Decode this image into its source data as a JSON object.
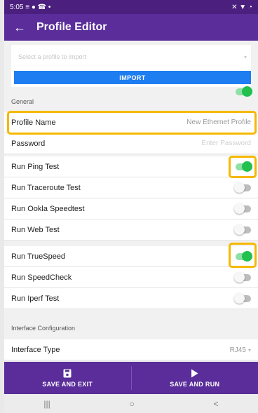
{
  "status_bar": {
    "time": "5:05",
    "left_icons": "≡ ● ☎ •",
    "right_icons": "✕ ▼ ◔"
  },
  "app_bar": {
    "title": "Profile Editor"
  },
  "import": {
    "placeholder": "Select a profile to import",
    "button_label": "IMPORT"
  },
  "general": {
    "header": "General",
    "profile_name": {
      "label": "Profile Name",
      "value": "New Ethernet Profile"
    },
    "password": {
      "label": "Password",
      "placeholder": "Enter Password"
    },
    "toggles": [
      {
        "label": "Run Ping Test",
        "on": true
      },
      {
        "label": "Run Traceroute Test",
        "on": false
      },
      {
        "label": "Run Ookla Speedtest",
        "on": false
      },
      {
        "label": "Run Web Test",
        "on": false
      },
      {
        "label": "Run TrueSpeed",
        "on": true
      },
      {
        "label": "Run SpeedCheck",
        "on": false
      },
      {
        "label": "Run Iperf Test",
        "on": false
      }
    ],
    "general_toggle_on": true
  },
  "interface": {
    "header": "Interface Configuration",
    "type": {
      "label": "Interface Type",
      "value": "RJ45"
    }
  },
  "bottom": {
    "save_exit_label": "SAVE AND EXIT",
    "save_run_label": "SAVE AND RUN"
  },
  "nav": {
    "recents": "|||",
    "home": "○",
    "back": "<"
  },
  "colors": {
    "primary": "#5a2d9a",
    "accent_blue": "#1e7df0",
    "toggle_on": "#22c04d",
    "highlight": "#f5b800"
  }
}
